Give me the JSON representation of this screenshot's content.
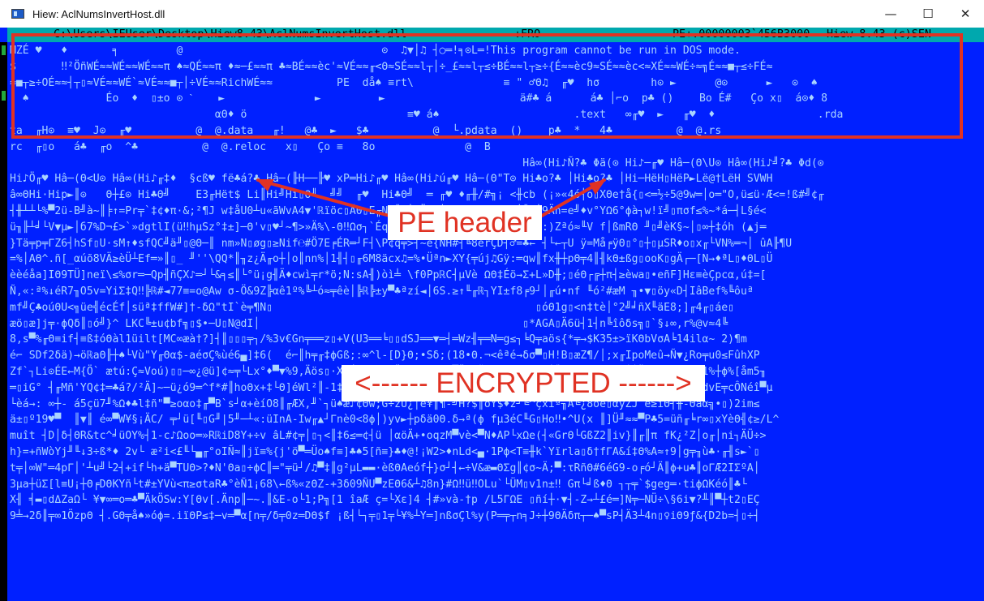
{
  "window": {
    "title": "Hiew: AclNumsInvertHost.dll",
    "controls": {
      "minimize": "—",
      "maximize": "☐",
      "close": "✕"
    }
  },
  "status_bar": {
    "path": "C:\\Users\\IEUser\\Desktop\\Hiew8.43\\AclNumsInvertHost.dll",
    "mode": "↓FRO --------",
    "offset": "PE+.00000003`456B3000",
    "version": "Hiew 8.43 (c)SEN"
  },
  "hex_lines": [
    "MZÉ ♥   ♦       ╕         @                               ⊙  ♫▼│♫ ┤○═!╕⊙L═!This program cannot be run in DOS mode.",
    "$       ‼²ÖñWÉ≈≈WÉ≈≈WÉ≈≈π ♠≈QÉ≈≈π ♦≈─£≈≈π ♣≈BÉ≈≈èc'≈VÉ≈≈╓<Θ≈SÉ≈≈l┬│÷_£≈≈l┬≤÷BÉ≈≈l┬≥÷{É≈≈èc9≈SÉ≈≈èc<≈XÉ≈≈WÉ÷≈╗É≈≈■┬≤÷FÉ≈",
    "≈■┬≥÷OÉ≈≈┤┬▯≈VÉ≈≈WÉ`≈VÉ≈≈■┬│÷VÉ≈≈RichWÉ≈≈          PE  då♠ ≡rt\\              ≡ \" ♂Θ♫  ╓♥  hσ        h⊙ ►      @⊙      ►   ⊙  ♠",
    "  ♠            Éo  ♦  ▯±o ⊙ ˋ    ►              ►         ►                     ä#♣ á      á♣ │⌐o  p♣ ()    Bo É#   Ço x▯  á⊙♦ 8",
    "                                αΘ♦ ö                         ≡♥ á♠                     .text   ∞╓♥  ►   ╓♥  ♦                .rda",
    "ta  ╓H⊙  ≡♥  J⊙  ╓♥          @  @.data   ╓!   @♣  ►   $♣          @  └.pdata  ()    p♣  *   4♣          @  @.rs",
    "rc  ╓▯o   á♣  ╓o  ^♣          @  @.reloc   x▯   Ço ≡   8o              @  B",
    "                                                                                Hâ∞(Hi♪Ñ?♣ Φä(⊙ Hi♪─╓♥ Hâ─(Θ\\U⊙ Hâ∞(Hi♪╝?♣ Φd(⊙",
    "Hi♪Ö╓♥ Hâ─(Θ<U⊙ Hâ∞(Hi♪╓‡♦  §cß♥ fë♣á?♣ Hâ─(╟H──╟♥ xP═Hi♪╓♥ Hâ∞(Hi♪ú╓♥ Hâ─(Θ\"T⊙ Hi♣o?♣ │Hi♣o?♣ │Hi─HëH▯HëP►Lë@†LëH SVWH",
    "â∞ΘHi·Hip►║⊙   Θ┼£⊙ Hi♣Θ╝    E3╓Hët$ Li║Hi╝Hi▯Θ╝  ╝╝  ╓♥  Hi♣Θ╝  ═ ╓♥ ♦╓╫/#╗¡ <╫cb (¡»«4ó┤o▯XΘe†å{▯<═½÷5@9w═│o═\"O,ü≤ü·Æ<=!ß#╝¢╓",
    "┤╫┴┴└%▀2ü-B╝à~║╞↑=Pr╤`‡¢♦π·&;²¶J w‡åU0┴u«ãWvA4▼'ℝïöc▯Ã0▯E╓N4╝‡│EÖS╤└ßrQ∞Y²&δnΘo┘╝ü┤9Äñ=e╝♦v°YΩ6°ϕà┐w!ï╝▯πσf≤%~*á─┤L§é<",
    "ü╖╟┴╛└V▼µ►│б7%D¬£>`»dgtlI(ü‼hµSz°‡±]─Θ'v▯♥┘~¶>»Ä%\\-Θ‼Ωσ┐`ÉqΘ0í1≈<¿èΘqq╖(d999Θi°╜¶{R:)Zªó≈╙V f│ßmRΘ ╜▯╝èK§~│▯∞┼‡óh (▲j═",
    "}Tä╤p╤ΓZ6┤hSf▯U·sM↑♦sfQC╝ä╜▯@Θ─║ nm»N▯øg▯≥Nif℮#Ö7E╒ÉR═┘F┤\\P¢q╤>┤~é{ÑH#┤╚8èrÇD┤♂=♣← ┤└←┬U ÿ=Må╒ÿΘ▯°▯┼▯µSR♦o▯x╓└VN%═¬│ ûA╟¶U",
    "=%│AΘ^.ñ[_αúõ8VÄ≥èÜ┴Ef═»║▯_ ╜''\\QQ*║╖z¿Ä╓o┼│o║nn%│1╢┤▯╓6M8äcx♫=%•Üªn►XY{╤új♫Gÿ:═qw║fx╫┼pΘ╤4║╢kΘ±ßg▯ooK▯gÄ┌─[N→♦ªL▯♦ΘL▯Ü",
    "èèéåa]IΘ9TÜ]neï\\≤%σr═─Qp╢ñÇX♪═┘└&╕≤║└°ü¡g╢Ä♦cwì╤r*ö;N:sA╢)òì╧ \\f0PpℝC┤µVè ΩΘ‡Éö→Σ+L»D╫;▯éΘ┌╔┼π┤≥èwa▯•eñF]Hε≡èÇpcα,ú‡=[",
    "Ñ,«:ª%↓éR7╖O5v=YiΣ‡Q‼╠ℝ#◄77≡=o@Aw σ-Ö&9Z╠αê1º%╚┴ó≈╤êè│╠ℝ╠±y▀♣ªzí◄│6S.≥↑╙╓ℝ┐YI±f8╒9┘│╓ú•nf ╙ó²#æM ╖•▼▯öy«D┤IâBef%╚ôuª",
    "mf╝Ç♣oúΘU<╗üe╣écÉf│süª‡ffW#]†-δΩ\"tI`è╤¶N▯                                         ▯óΘ1g▯<n‡tè│°2╝╛ñX╙äE8;]╓4╓▯áe▯",
    "æö▯æ]j╤·ϕQδ║▯ó╝}^ LKC╚±u¢bf╗▯$•─U▯N@dI│                                         ▯*AGA▯Ä6ü┤1┤n╚îôδs╗▯`§↓∞,r%@v≈4╚",
    "8,s▀%╓Θ≡if┤≡ß‡óΘàl1üilt[MC∞æà†?]┤║▯▯▯╤┐/%3v€Gn╤══z▯+V(U3══╘▯▯dSJ══▼═┤═Wz╢╤═N═g≤┐╘Q╤aös{*╤→$K35±>ïKΘbVσA╘14ilα~ 2)¶m",
    "é⌐ SDf2δä)→öℝaΘ╟┼♠└Vù\"Y╓Θα$-aéσÇ%ùé6▄]‡6(  é⌐║h╤╓‡ϕGß;:∞^l-[D}Θ;•Sδ;(18•Θ.¬<êªé→δσ▀▯H!B▯æZ¶/│;x╓IpoMeû→Ñ▼¿Ro╤u0≤FûhXP",
    "Zf`┐Li⊙ÉE←M{Ö` ætú:Ç≈Voú)▯▯─∞¿@ü]¢≈╤└Lx°♦▀▼%9,Äös▯·XjÉσLΘΘz@Ü±öδä-rüö▀ÜæNÑoS±Γä⊙-_┌▯│║W▯I³A╤e♪M♪└└Ä• t Tj>Θ≡1%┼ϕ%[åm5╖",
    "═▯iG° ┤╓Mñ'YQ¢‡═♣á?/²Ä]~─ü¿ó9═^f*#║hoΘx+‡└Θ]éWl²║-1‡♥6│pÑΘD→òà╝↓‡└^z└ÄG4┼]R3-╓▯N ▯ü 7\\¥E4 ;▀└%ö^ ╤4äù'îe┐◄.<dvE╤cÔNéî▀µ",
    "└èá→: ∞┼- á5çü7╜%Ω♦♣l‡ñ\"▀≥oαo‡╓▀B`s┘α+èíO8║╓ÆX,╜`┐ü♠æ♪¢Θw;G÷zU¿│ê¥║¶-╝H?$║öY$♦z┘╚^çxiª╖A╚¿8öè▯αyZJ`é≥iΘ┤╫-Θàα╗•▯)2im≤",
    "ä±▯º19♥▀  ║▼║ é∞▀W¥§¡ÄC/ ╤┘ü[╙▯G╜|5╜─┴«:üInA-Iw╓▲┘Γnè0<8ϕ│)yv►┼pδä0Θ.δ→ª(ϕ fµ3éC╙G▯Ho‼•^U(x ║]Ü╜≈≈▀P♣5=üñ╓╘r∞▯xYèΘ╣¢≥/L^",
    "muît ┤D│δ┤ΘR&tc^╛üOY%┤1-c♪Ωoo═»RℝiD8Y+÷v âL#¢╤│▯┐<║‡6≤═¢┤ü │αöÄ+•oqzM▀vè<▀N♦AP└xΩe(┤«GrΘ└GßZ2║iv}║╓║π fK¿²Z│o╓│ni┐ÄÜ÷>",
    "h}=+ñWòYj╜╙↓3÷ß*♦ 2v└ æ²i<£╙└▄╓°oIÑ≈║jï≡%{j'ö▀═Üo♠f≡]♣♠5[ñ≡}♣♦@!¡W2>♦nLd<▄·1Pϕ<T≡╫k`Yïrla▯δ†fΓA&í‡Θ%A≈↑9│g╤╖ù♣·╓╢s►`▯",
    "t╤│∞W\"═4pΓ│'┴u╝└2┤+if└h+ä▀TUΘ>?♦N'Θa▯÷ϕC║═\"╤ü┘/♫▀‡║g²µL▬▬·èßΘAeóf┼}σ┘┤←÷V&æ▬ΘΣg║¢σ~Ä;▀:τRñΘ#6éG9-o╒ó┘Ä║ϕ+u♣║oΓÆ2IΣºA│",
    "3µa┼üΣ[l≡U¡┼Θ╒DΘKYñ└t#±YVù<π≥σtaR♣°èÑ1¡68\\←ß%«zΘZ-+3δ09ÑU▀zEΘ6&┴♫8n}#Ω‼ü‼OLu`└ÜM▯v1n±‼ Gπ└╛ß♦Θ ┐┬╤`$geg═·tiϕΩKéó║♣└",
    "X╢ ╡▬▯dΔZaΩ└ ¥▼∞═o═♣▀ÄkÖSw:Y[Θv[.Änp║─~.║&E-o└1;P╗[1 îaÆ ç=└Xε]4 ┤#»và-†p /L5ΓΩE ▯ñí┼·▼┤-Z→┴£é═]N╤─NÜ÷\\§6i▼?╨║▀┼t2▯EÇ",
    "9╧→2δ║╤∞1ÖzpΘ ┤.GΘ╤å♠»óϕ=.iïΘP≤‡─v═▀α[n╤/δ╤0z═DΘ$f ¡ß┤└┐╤▯1╤└¥%┴Y═]nßσÇl%y(P═╤┬n╕J÷┼9ΘÄδπ┬─♠▀sP┤Ä3┴4n▯♀iΘ9ƒ&{D2b=┤▯÷┤"
  ],
  "annotations": {
    "pe_header_label": "PE header",
    "encrypted_label": "<------ ENCRYPTED ------>",
    "annotation_color": "#e03223"
  },
  "colors": {
    "console_bg": "#0020ff",
    "text": "#aad4ff",
    "status_bar_bg": "#00a8ae"
  },
  "icons": {
    "app_icon": "hiew-app-icon"
  }
}
